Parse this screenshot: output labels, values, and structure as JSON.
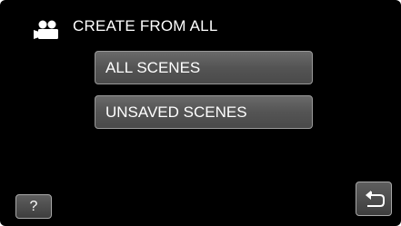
{
  "header": {
    "mode_icon": "video-camera-icon",
    "title": "CREATE FROM ALL"
  },
  "menu": {
    "items": [
      {
        "label": "ALL SCENES"
      },
      {
        "label": "UNSAVED SCENES"
      }
    ]
  },
  "footer": {
    "help_label": "?",
    "back_icon": "return-arrow-icon"
  },
  "colors": {
    "background": "#000000",
    "button_fill": "#545454",
    "button_border": "#9a9a9a",
    "text": "#ffffff"
  }
}
